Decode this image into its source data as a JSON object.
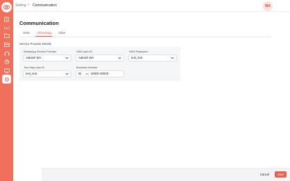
{
  "breadcrumb": {
    "parent": "Setting",
    "current": "Communication"
  },
  "user": {
    "initials": "MA"
  },
  "page": {
    "title": "Communication"
  },
  "tabs": [
    {
      "label": "SMS",
      "active": false
    },
    {
      "label": "Whatsapp",
      "active": true
    },
    {
      "label": "Viber",
      "active": false
    }
  ],
  "section": {
    "title": "Service Provider Details"
  },
  "form": {
    "provider": {
      "label": "WhatsApp Service Provider",
      "value": "Aakash WA"
    },
    "hsm_user": {
      "label": "HSM User ID",
      "value": "Aakash WA"
    },
    "hsm_password": {
      "label": "HSM Password",
      "value": "test_test"
    },
    "two_way_user": {
      "label": "Two Way User ID",
      "value": "test_test"
    },
    "business_number": {
      "label": "Business Number",
      "country_code": "91",
      "value": "00000 00000"
    }
  },
  "actions": {
    "cancel": "Cancel",
    "save": "Save"
  },
  "colors": {
    "accent": "#f0705b",
    "primary_button": "#e8604d"
  },
  "sidebar_icons": [
    "clipboard-icon",
    "broadcast-icon",
    "folder-icon",
    "folder-open-icon",
    "headset-icon",
    "chart-icon",
    "monitor-icon",
    "settings-icon"
  ]
}
